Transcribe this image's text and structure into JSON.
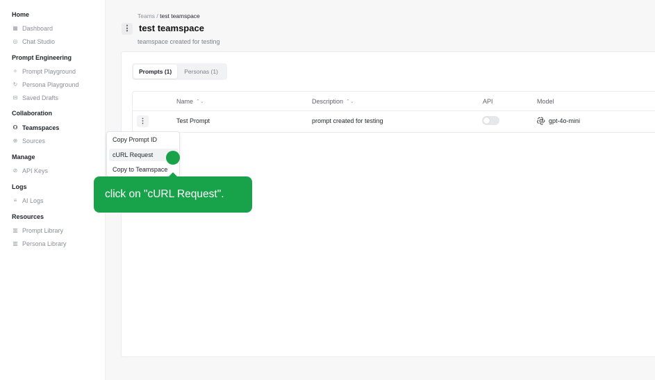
{
  "sidebar": {
    "sections": [
      {
        "title": "Home",
        "items": [
          {
            "label": "Dashboard",
            "icon": "calendar-grid-icon"
          },
          {
            "label": "Chat Studio",
            "icon": "chat-icon"
          }
        ]
      },
      {
        "title": "Prompt Engineering",
        "items": [
          {
            "label": "Prompt Playground",
            "icon": "sparkle-icon"
          },
          {
            "label": "Persona Playground",
            "icon": "refresh-icon"
          },
          {
            "label": "Saved Drafts",
            "icon": "save-icon"
          }
        ]
      },
      {
        "title": "Collaboration",
        "items": [
          {
            "label": "Teamspaces",
            "icon": "team-icon"
          },
          {
            "label": "Sources",
            "icon": "globe-icon"
          }
        ]
      },
      {
        "title": "Manage",
        "items": [
          {
            "label": "API Keys",
            "icon": "key-icon"
          }
        ]
      },
      {
        "title": "Logs",
        "items": [
          {
            "label": "AI Logs",
            "icon": "list-icon"
          }
        ]
      },
      {
        "title": "Resources",
        "items": [
          {
            "label": "Prompt Library",
            "icon": "library-icon"
          },
          {
            "label": "Persona Library",
            "icon": "library-icon"
          }
        ]
      }
    ]
  },
  "breadcrumb": {
    "parent": "Teams",
    "separator": " / ",
    "current": "test teamspace"
  },
  "header": {
    "title": "test teamspace",
    "description": "teamspace created for testing",
    "menu_glyph": "⋮"
  },
  "tabs": [
    {
      "label": "Prompts (1)",
      "active": true
    },
    {
      "label": "Personas (1)",
      "active": false
    }
  ],
  "table": {
    "columns": [
      "Name",
      "Description",
      "API",
      "Model"
    ],
    "sort_glyph": "⌃⌄",
    "rows": [
      {
        "name": "Test Prompt",
        "description": "prompt created for testing",
        "api_enabled": false,
        "model": "gpt-4o-mini"
      }
    ]
  },
  "dropdown": {
    "items": [
      "Copy Prompt ID",
      "cURL Request",
      "Copy to Teamspace"
    ],
    "highlighted_index": 1
  },
  "tooltip": {
    "text": "click on \"cURL Request\"."
  },
  "colors": {
    "accent": "#18a24a"
  }
}
